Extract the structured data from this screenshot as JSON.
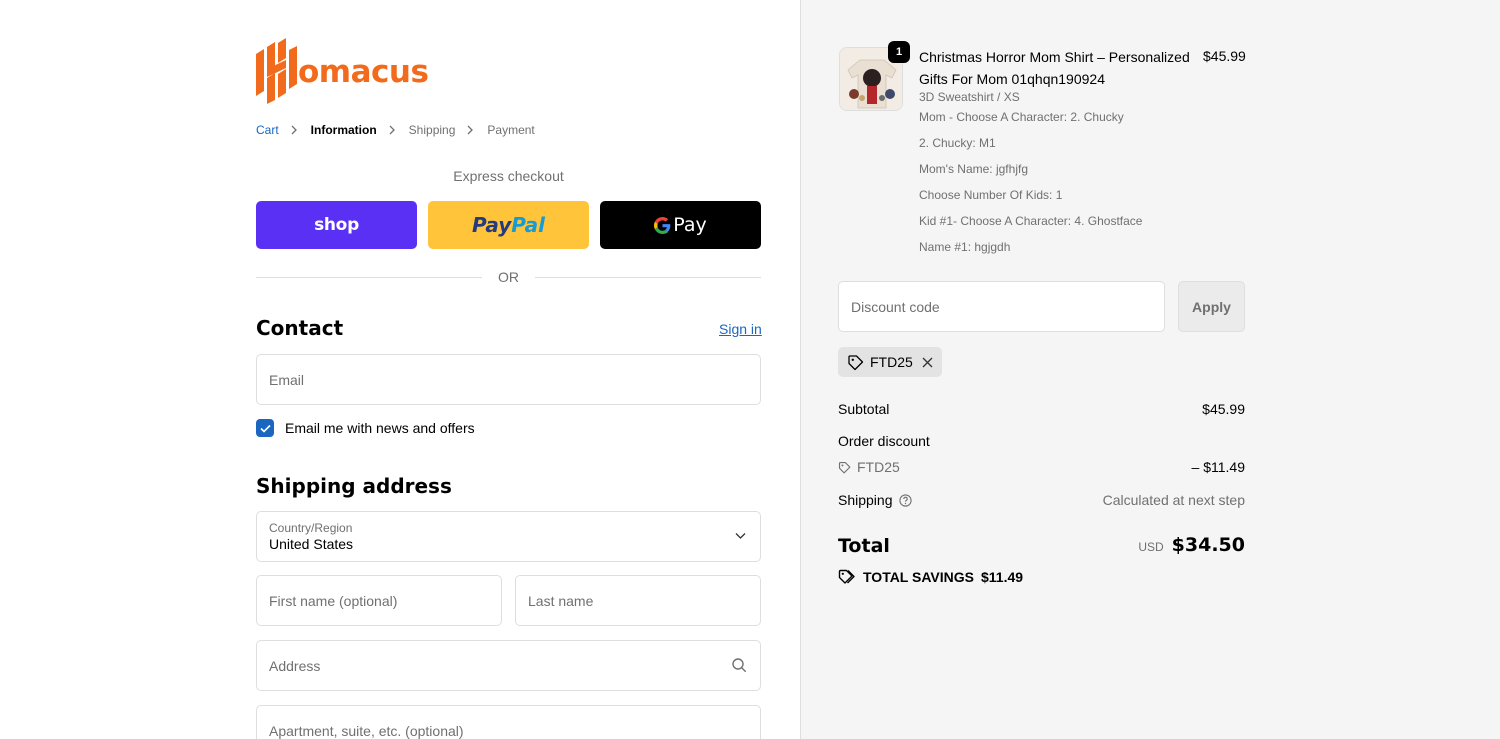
{
  "brand": {
    "name": "omacus",
    "color": "#f26a1b"
  },
  "breadcrumb": [
    {
      "label": "Cart",
      "state": "link"
    },
    {
      "label": "Information",
      "state": "current"
    },
    {
      "label": "Shipping",
      "state": "upcoming"
    },
    {
      "label": "Payment",
      "state": "upcoming"
    }
  ],
  "express": {
    "title": "Express checkout",
    "shop_label": "shop",
    "paypal_label_1": "Pay",
    "paypal_label_2": "Pal",
    "gpay_label": "Pay",
    "or_label": "OR"
  },
  "contact": {
    "title": "Contact",
    "sign_in": "Sign in",
    "email_placeholder": "Email",
    "newsletter_label": "Email me with news and offers",
    "newsletter_checked": true
  },
  "shipping": {
    "title": "Shipping address",
    "country_label": "Country/Region",
    "country_value": "United States",
    "first_name_placeholder": "First name (optional)",
    "last_name_placeholder": "Last name",
    "address_placeholder": "Address",
    "apartment_placeholder": "Apartment, suite, etc. (optional)"
  },
  "order": {
    "item": {
      "quantity": "1",
      "title": "Christmas Horror Mom Shirt – Personalized Gifts For Mom 01qhqn190924",
      "price": "$45.99",
      "variant": "3D Sweatshirt / XS",
      "properties": [
        "Mom - Choose A Character: 2. Chucky",
        "2. Chucky: M1",
        "Mom's Name: jgfhjfg",
        "Choose Number Of Kids: 1",
        "Kid #1- Choose A Character: 4. Ghostface",
        "Name #1: hgjgdh"
      ]
    },
    "discount_placeholder": "Discount code",
    "apply_label": "Apply",
    "applied_code": "FTD25",
    "subtotal_label": "Subtotal",
    "subtotal_value": "$45.99",
    "order_discount_label": "Order discount",
    "discount_code": "FTD25",
    "discount_value": "– $11.49",
    "shipping_label": "Shipping",
    "shipping_value": "Calculated at next step",
    "total_label": "Total",
    "currency": "USD",
    "total_value": "$34.50",
    "savings_label": "TOTAL SAVINGS",
    "savings_value": "$11.49"
  },
  "colors": {
    "accent": "#1a66c0",
    "shop": "#5a31f4",
    "paypal": "#ffc439",
    "gpay": "#000000"
  }
}
